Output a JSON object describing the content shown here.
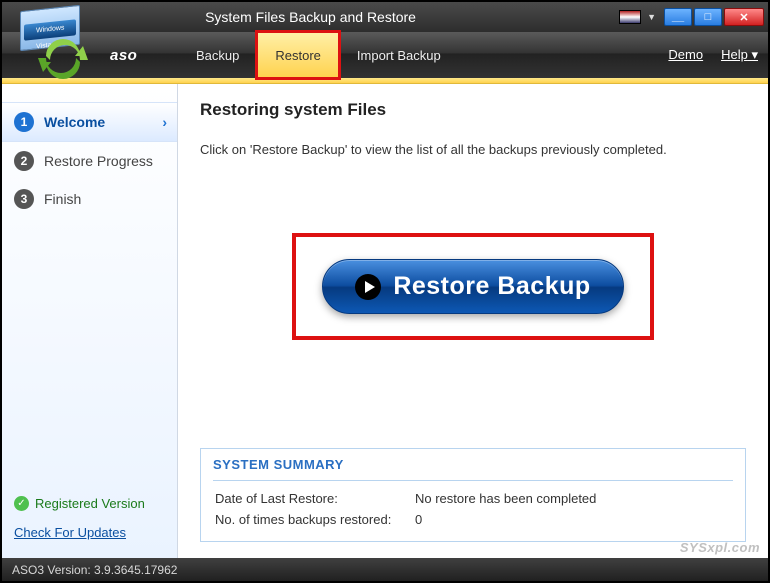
{
  "window": {
    "title": "System Files Backup and Restore"
  },
  "header": {
    "brand": "aso",
    "tabs": {
      "backup": "Backup",
      "restore": "Restore",
      "import": "Import Backup"
    },
    "links": {
      "demo": "Demo",
      "help": "Help"
    },
    "icon_vista": "Windows Vista"
  },
  "sidebar": {
    "steps": {
      "s1": {
        "num": "1",
        "label": "Welcome"
      },
      "s2": {
        "num": "2",
        "label": "Restore Progress"
      },
      "s3": {
        "num": "3",
        "label": "Finish"
      }
    },
    "registered": "Registered Version",
    "updates": "Check For Updates"
  },
  "content": {
    "title": "Restoring system Files",
    "desc": "Click on 'Restore Backup' to view the list of all the backups previously completed.",
    "button": "Restore Backup",
    "summary": {
      "header": "SYSTEM SUMMARY",
      "row1_k": "Date of Last Restore:",
      "row1_v": "No restore has been completed",
      "row2_k": "No. of times backups restored:",
      "row2_v": "0"
    }
  },
  "watermark": "SYSxpl.com",
  "status": "ASO3 Version: 3.9.3645.17962"
}
